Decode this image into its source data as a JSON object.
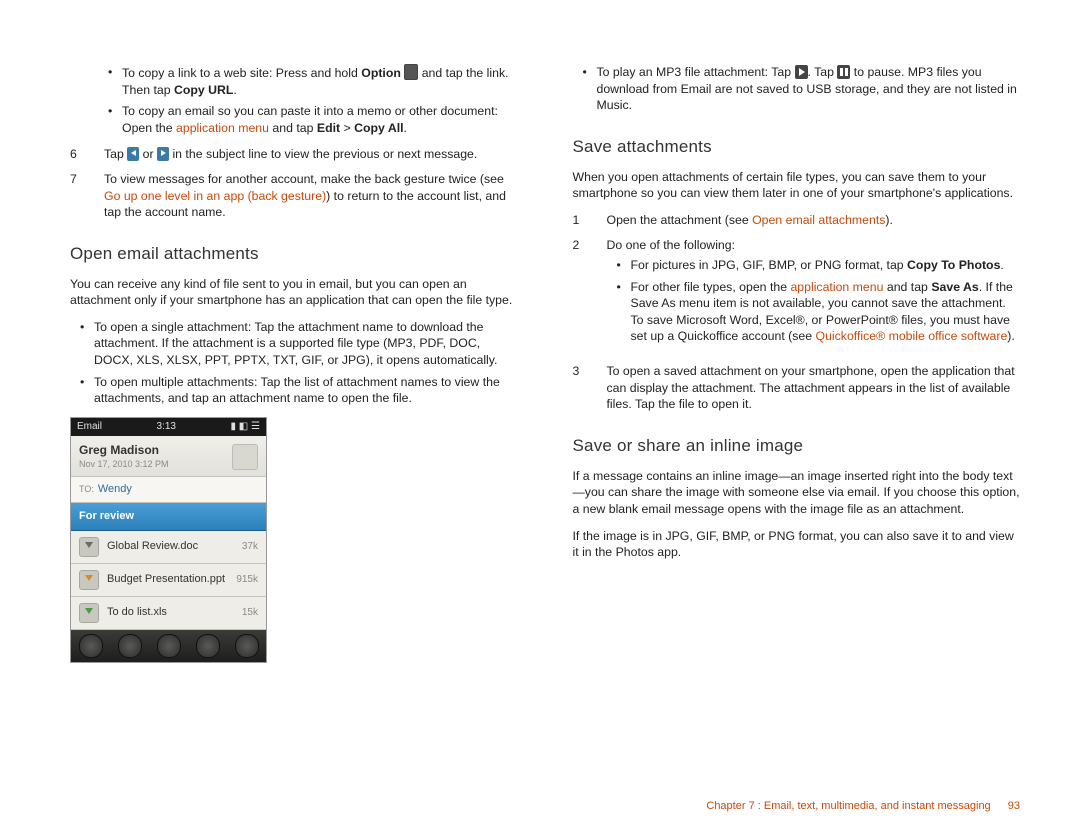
{
  "left": {
    "bullet1a_pre": "To copy a link to a web site: Press and hold ",
    "bullet1a_bold": "Option",
    "bullet1a_post": " and tap the link. Then tap ",
    "bullet1a_bold2": "Copy URL",
    "bullet1b_pre": "To copy an email so you can paste it into a memo or other document: Open the ",
    "bullet1b_link": "application menu",
    "bullet1b_mid": " and tap ",
    "bullet1b_bold": "Edit",
    "bullet1b_gt": " > ",
    "bullet1b_bold2": "Copy All",
    "step6_num": "6",
    "step6_pre": "Tap ",
    "step6_mid": " or ",
    "step6_post": " in the subject line to view the previous or next message.",
    "step7_num": "7",
    "step7_pre": "To view messages for another account, make the back gesture twice (see ",
    "step7_link": "Go up one level in an app (back gesture)",
    "step7_post": ") to return to the account list, and tap the account name.",
    "h_open": "Open email attachments",
    "open_intro": "You can receive any kind of file sent to you in email, but you can open an attachment only if your smartphone has an application that can open the file type.",
    "open_b1": "To open a single attachment: Tap the attachment name to download the attachment. If the attachment is a supported file type (MP3, PDF, DOC, DOCX, XLS, XLSX, PPT, PPTX, TXT, GIF, or JPG), it opens automatically.",
    "open_b2": "To open multiple attachments: Tap the list of attachment names to view the attachments, and tap an attachment name to open the file.",
    "phone": {
      "status_left": "Email",
      "status_time": "3:13",
      "name": "Greg Madison",
      "date": "Nov 17, 2010 3:12 PM",
      "to_label": "TO:",
      "to_name": "Wendy",
      "subject": "For review",
      "rows": [
        {
          "name": "Global Review.doc",
          "size": "37k"
        },
        {
          "name": "Budget Presentation.ppt",
          "size": "915k"
        },
        {
          "name": "To do list.xls",
          "size": "15k"
        }
      ]
    }
  },
  "right": {
    "mp3_pre": "To play an MP3 file attachment: Tap ",
    "mp3_mid": ". Tap ",
    "mp3_post": " to pause. MP3 files you download from Email are not saved to USB storage, and they are not listed in Music.",
    "h_save": "Save attachments",
    "save_intro": "When you open attachments of certain file types, you can save them to your smartphone so you can view them later in one of your smartphone's applications.",
    "step1_num": "1",
    "step1_pre": "Open the attachment (see ",
    "step1_link": "Open email attachments",
    "step1_post": ").",
    "step2_num": "2",
    "step2_pre": "Do one of the following:",
    "step2_b1_pre": "For pictures in JPG, GIF, BMP, or PNG format, tap ",
    "step2_b1_bold": "Copy To Photos",
    "step2_b2_pre": "For other file types, open the ",
    "step2_b2_link": "application menu",
    "step2_b2_mid": " and tap ",
    "step2_b2_bold": "Save As",
    "step2_b2_post": ". If the Save As menu item is not available, you cannot save the attachment. To save Microsoft Word, Excel®, or PowerPoint® files, you must have set up a Quickoffice account (see ",
    "step2_b2_link2": "Quickoffice® mobile office software",
    "step2_b2_end": ").",
    "step3_num": "3",
    "step3_text": "To open a saved attachment on your smartphone, open the application that can display the attachment. The attachment appears in the list of available files. Tap the file to open it.",
    "h_inline": "Save or share an inline image",
    "inline_p1": "If a message contains an inline image—an image inserted right into the body text—you can share the image with someone else via email. If you choose this option, a new blank email message opens with the image file as an attachment.",
    "inline_p2": "If the image is in JPG, GIF, BMP, or PNG format, you can also save it to and view it in the Photos app."
  },
  "footer": {
    "chapter": "Chapter 7 : Email, text, multimedia, and instant messaging",
    "page": "93"
  }
}
